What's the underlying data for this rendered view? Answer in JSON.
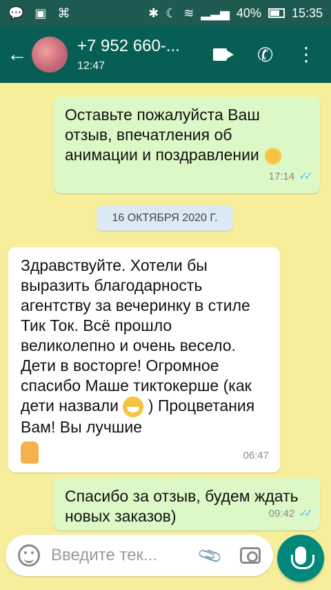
{
  "status": {
    "battery": "40%",
    "time": "15:35"
  },
  "header": {
    "contact_name": "+7 952 660-...",
    "subtitle": "12:47"
  },
  "messages": [
    {
      "direction": "out",
      "text": "Оставьте пожалуйста Ваш отзыв, впечатления об анимации и поздравлении",
      "time": "17:14"
    },
    {
      "date_chip": "16 ОКТЯБРЯ 2020 Г."
    },
    {
      "direction": "in",
      "text_before": "Здравствуйте. Хотели бы выразить благодарность агентству за вечеринку в стиле Тик Ток. Всё прошло великолепно и очень весело. Дети в восторге! Огромное спасибо Маше тиктокерше (как дети назвали",
      "text_after": ") Процветания Вам! Вы лучшие",
      "time": "06:47"
    },
    {
      "direction": "out",
      "text": "Спасибо за отзыв, будем ждать новых заказов)",
      "time": "09:42"
    }
  ],
  "composer": {
    "placeholder": "Введите тек..."
  },
  "icons": {
    "back": "back-arrow-icon",
    "video": "video-call-icon",
    "call": "phone-icon",
    "menu": "more-vert-icon",
    "emoji": "emoji-icon",
    "attach": "attach-icon",
    "camera": "camera-icon",
    "mic": "mic-icon"
  },
  "colors": {
    "appbar": "#075e54",
    "statusbar": "#1f5a52",
    "chat_bg": "#f7ee9b",
    "outgoing": "#dcf8c6",
    "incoming": "#ffffff",
    "mic_button": "#00897b",
    "read_ticks": "#4fc3f7"
  }
}
